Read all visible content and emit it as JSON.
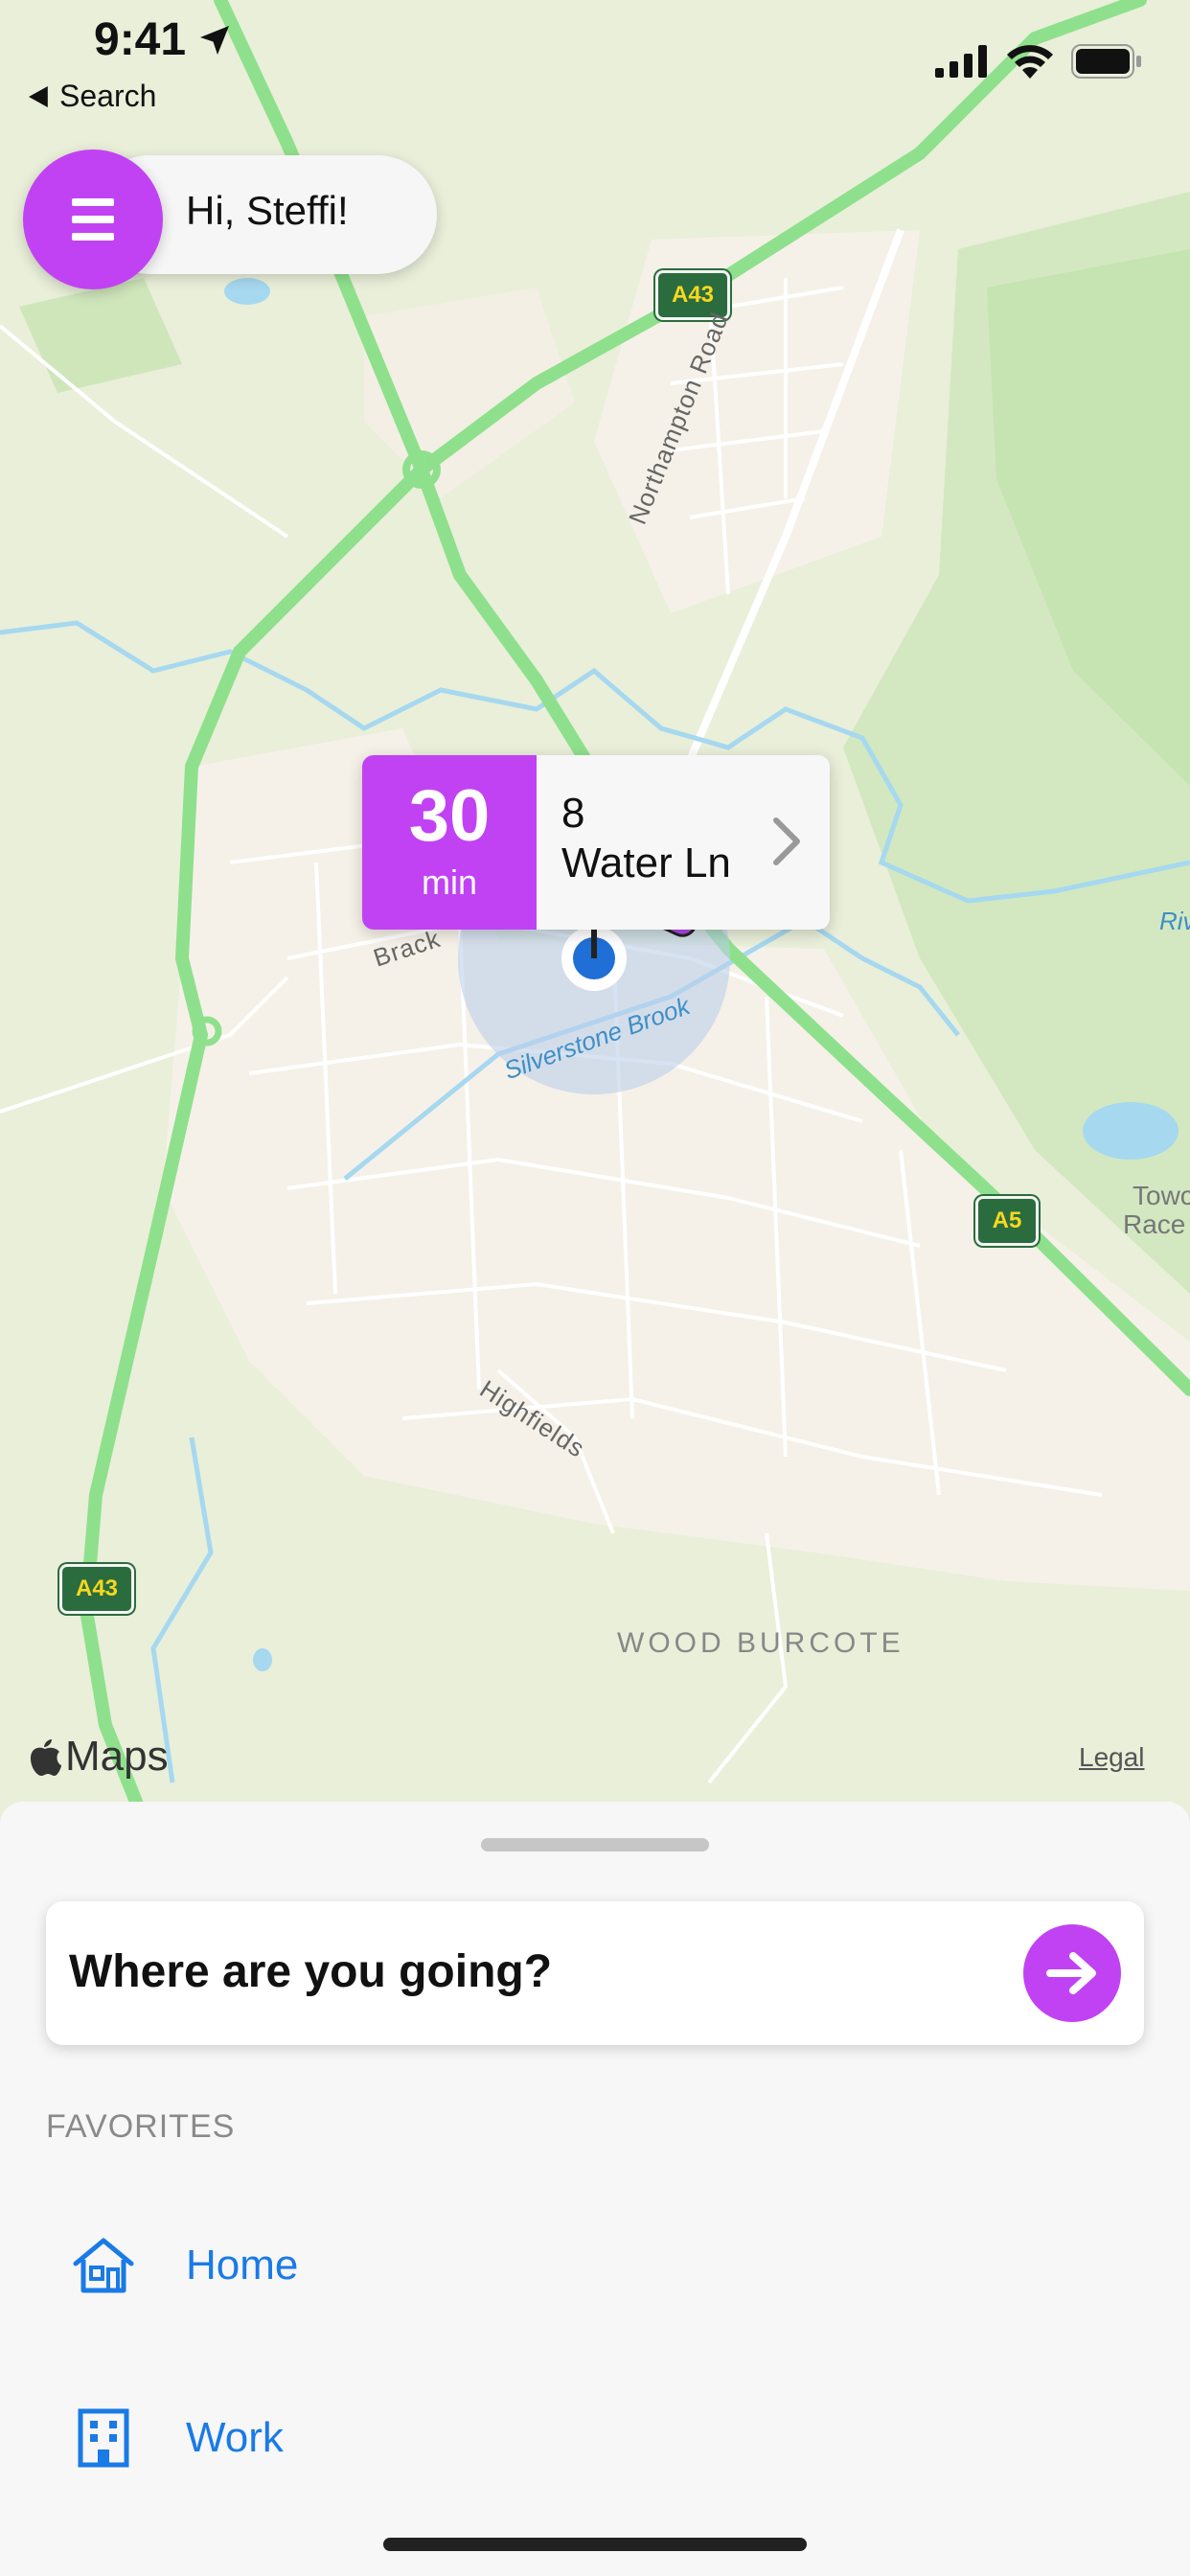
{
  "status_bar": {
    "time": "9:41",
    "back_label": "Search"
  },
  "greeting": {
    "text": "Hi, Steffi!"
  },
  "map": {
    "roads": {
      "a43_north": "A43",
      "a43_south": "A43",
      "a5": "A5",
      "northampton_road": "Northampton Road",
      "highfields": "Highfields",
      "brackley": "Brack",
      "river_right": "Riv"
    },
    "water": {
      "brook": "Silverstone Brook"
    },
    "places": {
      "wood_burcote": "WOOD BURCOTE",
      "towc_1": "Towc",
      "towc_2": "Race"
    },
    "attribution": "Maps",
    "legal": "Legal"
  },
  "callout": {
    "minutes": "30",
    "minutes_unit": "min",
    "address_number": "8",
    "address_street": "Water Ln"
  },
  "bottom_sheet": {
    "search_prompt": "Where are you going?",
    "favorites_header": "FAVORITES",
    "favorites": [
      {
        "label": "Home",
        "icon": "house-icon"
      },
      {
        "label": "Work",
        "icon": "building-icon"
      }
    ]
  },
  "colors": {
    "accent": "#c142f3",
    "link": "#1a7ae6",
    "road_major": "#8fe08d",
    "water": "#a6d8f0"
  }
}
